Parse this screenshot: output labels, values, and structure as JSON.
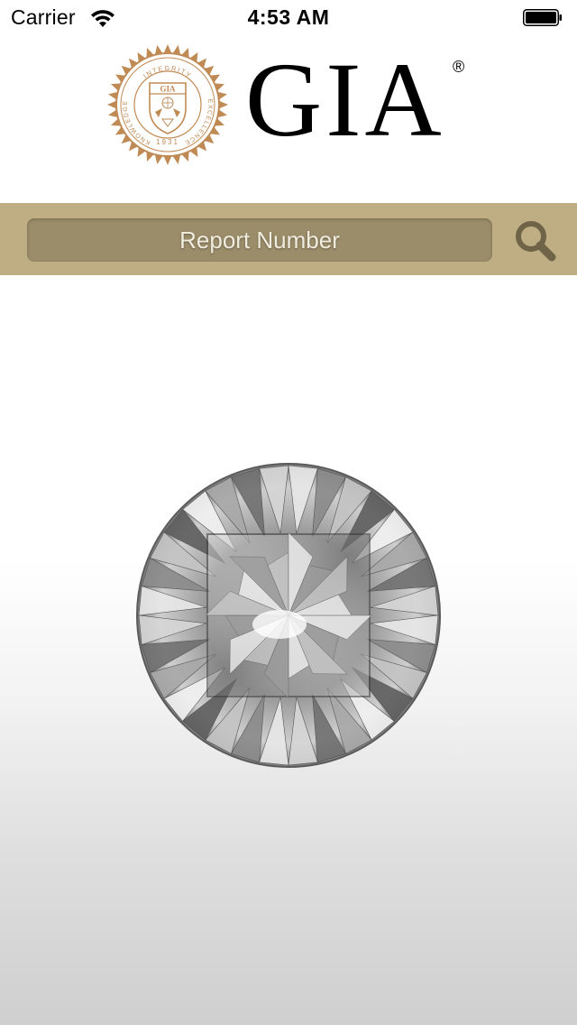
{
  "status_bar": {
    "carrier": "Carrier",
    "time": "4:53 AM",
    "wifi_icon": "wifi-icon",
    "battery_icon": "battery-icon"
  },
  "header": {
    "brand": "GIA",
    "registered_mark": "®",
    "seal": {
      "arc_top": "INTEGRITY",
      "arc_left": "KNOWLEDGE",
      "arc_right": "EXCELLENCE",
      "shield_text": "GIA",
      "year": "1931"
    }
  },
  "search": {
    "placeholder": "Report Number",
    "button_icon": "search-icon"
  },
  "colors": {
    "accent_bar": "#bfae83",
    "field_bg": "#9b8d69",
    "seal_gold": "#c08a55",
    "search_icon": "#6f6448"
  },
  "hero": {
    "image": "diamond-icon"
  }
}
